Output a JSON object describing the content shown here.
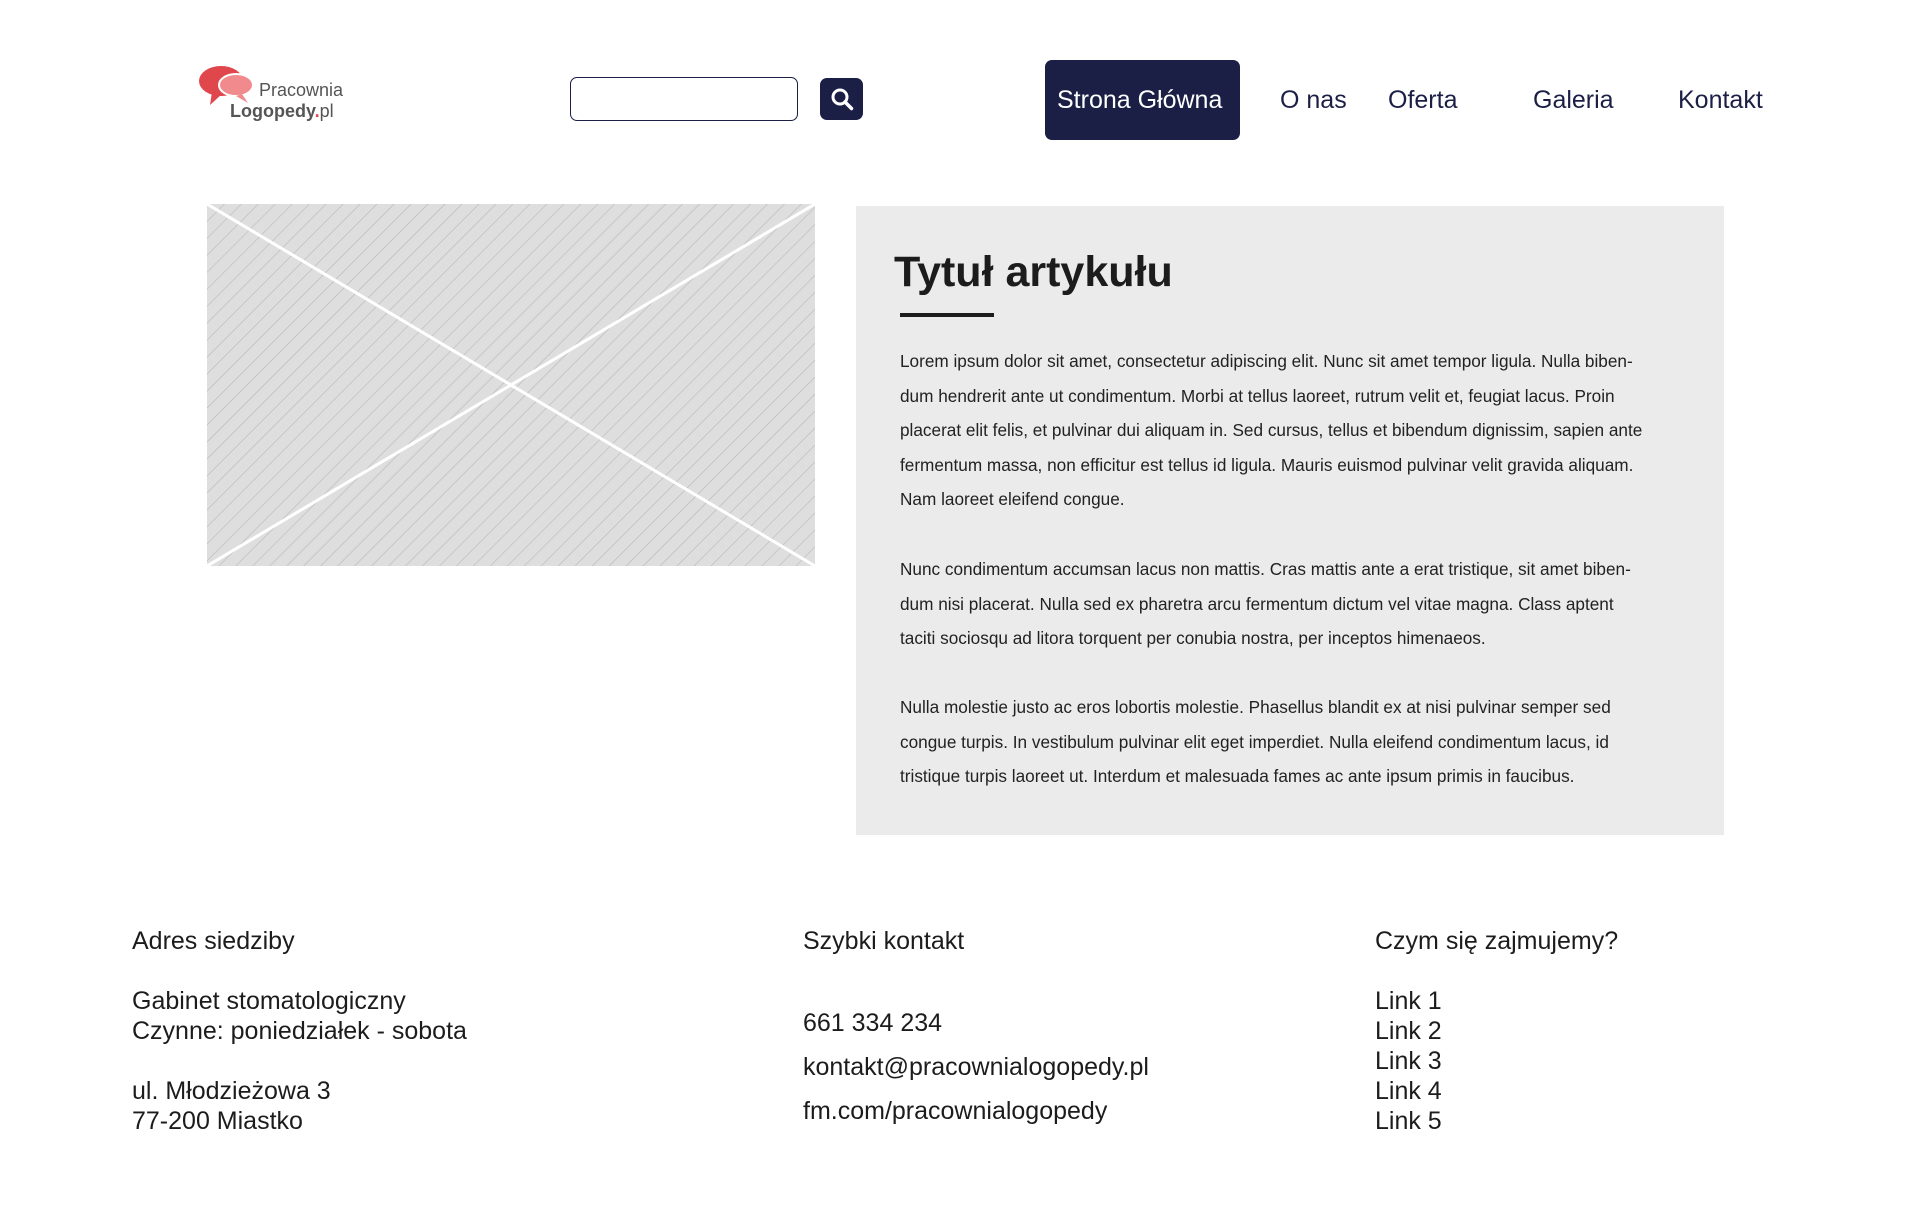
{
  "header": {
    "logo": {
      "line1": "Pracownia",
      "line2_bold": "Logopedy",
      "line2_dot": ".",
      "line2_suffix": "pl"
    },
    "search": {
      "placeholder": "",
      "value": ""
    },
    "nav": [
      {
        "label": "Strona Główna",
        "active": true
      },
      {
        "label": "O nas",
        "active": false
      },
      {
        "label": "Oferta",
        "active": false
      },
      {
        "label": "Galeria",
        "active": false
      },
      {
        "label": "Kontakt",
        "active": false
      }
    ]
  },
  "article": {
    "title": "Tytuł artykułu",
    "paragraphs": [
      [
        "Lorem ipsum dolor sit amet, consectetur adipiscing elit. Nunc sit amet tempor ligula. Nulla biben-",
        "dum hendrerit ante ut condimentum. Morbi at tellus laoreet, rutrum velit et, feugiat lacus. Proin",
        "placerat elit felis, et pulvinar dui aliquam in. Sed cursus, tellus et bibendum dignissim, sapien ante",
        "fermentum massa, non efficitur est tellus id ligula. Mauris euismod pulvinar velit gravida aliquam.",
        "Nam laoreet eleifend congue."
      ],
      [
        "Nunc condimentum accumsan lacus non mattis. Cras mattis ante a erat tristique, sit amet biben-",
        "dum nisi placerat. Nulla sed ex pharetra arcu fermentum dictum vel vitae magna. Class aptent",
        "taciti sociosqu ad litora torquent per conubia nostra, per inceptos himenaeos."
      ],
      [
        "Nulla molestie justo ac eros lobortis molestie. Phasellus blandit ex at nisi pulvinar semper sed",
        "congue turpis. In vestibulum pulvinar elit eget imperdiet. Nulla eleifend condimentum lacus, id",
        "tristique turpis laoreet ut. Interdum et malesuada fames ac ante ipsum primis in faucibus."
      ]
    ]
  },
  "footer": {
    "address": {
      "heading": "Adres siedziby",
      "name": "Gabinet stomatologiczny",
      "hours": "Czynne: poniedziałek - sobota",
      "street": "ul. Młodzieżowa 3",
      "city": "77-200 Miastko"
    },
    "contact": {
      "heading": "Szybki kontakt",
      "phone": "661 334 234",
      "email": "kontakt@pracownialogopedy.pl",
      "social": "fm.com/pracownialogopedy"
    },
    "links": {
      "heading": "Czym się zajmujemy?",
      "items": [
        "Link 1",
        "Link 2",
        "Link 3",
        "Link 4",
        "Link 5"
      ]
    }
  },
  "colors": {
    "navy": "#1b1f45",
    "logo_red": "#e0474c",
    "article_bg": "#ebebeb",
    "placeholder_bg": "#dedede"
  },
  "icons": {
    "search": "search-icon",
    "logo": "speech-bubbles-icon",
    "image_placeholder": "image-placeholder-icon"
  }
}
